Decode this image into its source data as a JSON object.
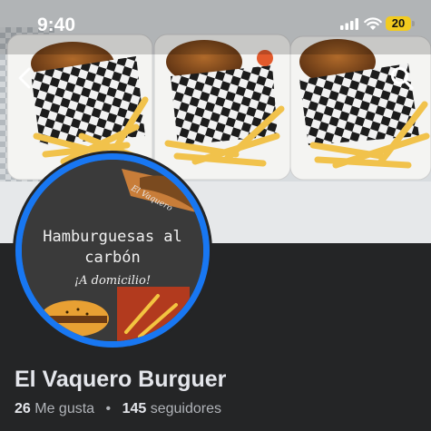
{
  "status_bar": {
    "time": "9:40",
    "battery": "20"
  },
  "cover": {
    "alt": "Tres cajas con hamburguesas y papas fritas"
  },
  "avatar": {
    "line1": "Hamburguesas al",
    "line2": "carbón",
    "tagline": "¡A domicilio!",
    "brand": "El Vaquero"
  },
  "page": {
    "name": "El Vaquero Burguer",
    "likes_count": "26",
    "likes_label": "Me gusta",
    "separator": "•",
    "followers_count": "145",
    "followers_label": "seguidores"
  },
  "icons": {
    "back": "chevron-left-icon",
    "search": "search-icon"
  },
  "colors": {
    "background": "#242526",
    "accent": "#1877f2",
    "battery": "#f2cb1f"
  }
}
